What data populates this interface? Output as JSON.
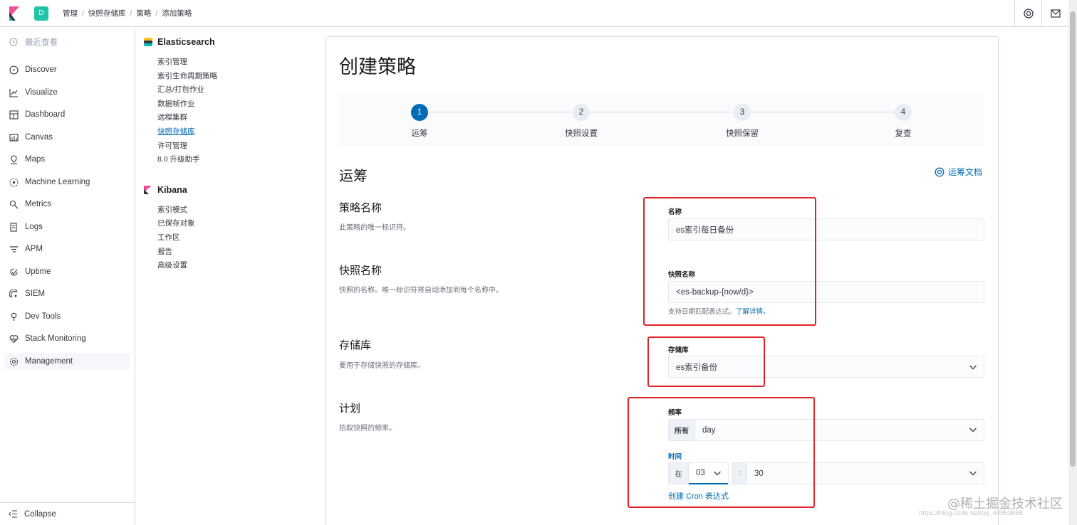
{
  "header": {
    "space_initial": "D",
    "breadcrumbs": [
      "管理",
      "快照存储库",
      "策略",
      "添加策略"
    ],
    "help_icon": "help-lifebuoy-icon",
    "mail_icon": "mail-icon"
  },
  "nav": {
    "recent": "最近查看",
    "items": [
      {
        "label": "Discover",
        "icon": "compass-icon"
      },
      {
        "label": "Visualize",
        "icon": "visualize-icon"
      },
      {
        "label": "Dashboard",
        "icon": "dashboard-icon"
      },
      {
        "label": "Canvas",
        "icon": "canvas-icon"
      },
      {
        "label": "Maps",
        "icon": "maps-icon"
      },
      {
        "label": "Machine Learning",
        "icon": "ml-icon"
      },
      {
        "label": "Metrics",
        "icon": "metrics-icon"
      },
      {
        "label": "Logs",
        "icon": "logs-icon"
      },
      {
        "label": "APM",
        "icon": "apm-icon"
      },
      {
        "label": "Uptime",
        "icon": "uptime-icon"
      },
      {
        "label": "SIEM",
        "icon": "siem-icon"
      },
      {
        "label": "Dev Tools",
        "icon": "devtools-icon"
      },
      {
        "label": "Stack Monitoring",
        "icon": "monitoring-icon"
      },
      {
        "label": "Management",
        "icon": "gear-icon"
      }
    ],
    "collapse": "Collapse"
  },
  "mgmt": {
    "elasticsearch_title": "Elasticsearch",
    "elasticsearch_links": [
      "索引管理",
      "索引生命周期策略",
      "汇总/打包作业",
      "数据帧作业",
      "远程集群",
      "快照存储库",
      "许可管理",
      "8.0 升级助手"
    ],
    "kibana_title": "Kibana",
    "kibana_links": [
      "索引模式",
      "已保存对象",
      "工作区",
      "报告",
      "高级设置"
    ]
  },
  "page": {
    "title": "创建策略",
    "steps": [
      {
        "num": "1",
        "label": "运筹"
      },
      {
        "num": "2",
        "label": "快照设置"
      },
      {
        "num": "3",
        "label": "快照保留"
      },
      {
        "num": "4",
        "label": "复查"
      }
    ],
    "section_title": "运筹",
    "doc_link": "运筹文档",
    "policy_name": {
      "title": "策略名称",
      "desc": "此策略的唯一标识符。",
      "label": "名称",
      "value": "es索引每日备份"
    },
    "snapshot_name": {
      "title": "快照名称",
      "desc": "快照的名称。唯一标识符将自动添加到每个名称中。",
      "label": "快照名称",
      "value": "<es-backup-{now/d}>",
      "help": "支持日期匹配表达式。",
      "help_link": "了解详情。"
    },
    "repository": {
      "title": "存储库",
      "desc": "要用于存储快照的存储库。",
      "label": "存储库",
      "value": "es索引备份"
    },
    "schedule": {
      "title": "计划",
      "desc": "拍取快照的频率。",
      "freq_label": "频率",
      "freq_prefix": "所有",
      "freq_value": "day",
      "time_label": "时间",
      "time_prefix": "在",
      "hour": "03",
      "colon": ":",
      "minute": "30",
      "cron_link": "创建 Cron 表达式"
    }
  },
  "watermark": "@稀土掘金技术社区",
  "watermark_url": "https://blog.csdn.net/qq_44953658",
  "colors": {
    "accent": "#006bb4",
    "highlight_box": "#e0232a"
  }
}
